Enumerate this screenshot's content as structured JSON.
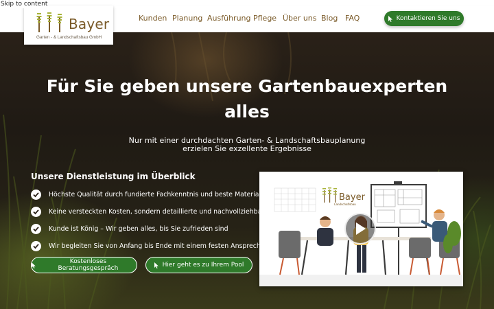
{
  "skip_link": "Skip to content",
  "logo": {
    "name": "Bayer",
    "subtitle": "Garten - & Landschaftsbau GmbH",
    "video_subtitle": "Landschaftsbau"
  },
  "nav": {
    "items": [
      {
        "label": "Kunden"
      },
      {
        "label": "Planung"
      },
      {
        "label": "Ausführung"
      },
      {
        "label": "Pflege"
      },
      {
        "label": "Über uns"
      },
      {
        "label": "Blog"
      },
      {
        "label": "FAQ"
      }
    ],
    "cta_label": "Kontaktieren Sie uns"
  },
  "hero": {
    "title_line1": "Für Sie geben unsere Gartenbauexperten",
    "title_line2": "alles",
    "subtitle_line1": "Nur mit einer durchdachten Garten- & Landschaftsbauplanung",
    "subtitle_line2": "erzielen Sie exzellente Ergebnisse"
  },
  "services": {
    "title": "Unsere Dienstleistung im Überblick",
    "items": [
      {
        "text": "Höchste Qualität durch fundierte Fachkenntnis und beste Materialien"
      },
      {
        "text": "Keine versteckten Kosten, sondern detaillierte und nachvollziehbare Preise"
      },
      {
        "text": "Kunde ist König – Wir geben alles, bis Sie zufrieden sind"
      },
      {
        "text": "Wir begleiten Sie von Anfang bis Ende mit einem festen Ansprechpartner"
      }
    ]
  },
  "buttons": {
    "consult": "Kostenloses Beratungsgespräch",
    "pool": "Hier geht es zu Ihrem Pool"
  },
  "colors": {
    "brand_green": "#2f7a2a",
    "logo_brown": "#7a5a28",
    "tree_green": "#a8b33a"
  },
  "icons": [
    "cursor-icon",
    "check-icon",
    "play-icon",
    "tree-logo-icon"
  ]
}
